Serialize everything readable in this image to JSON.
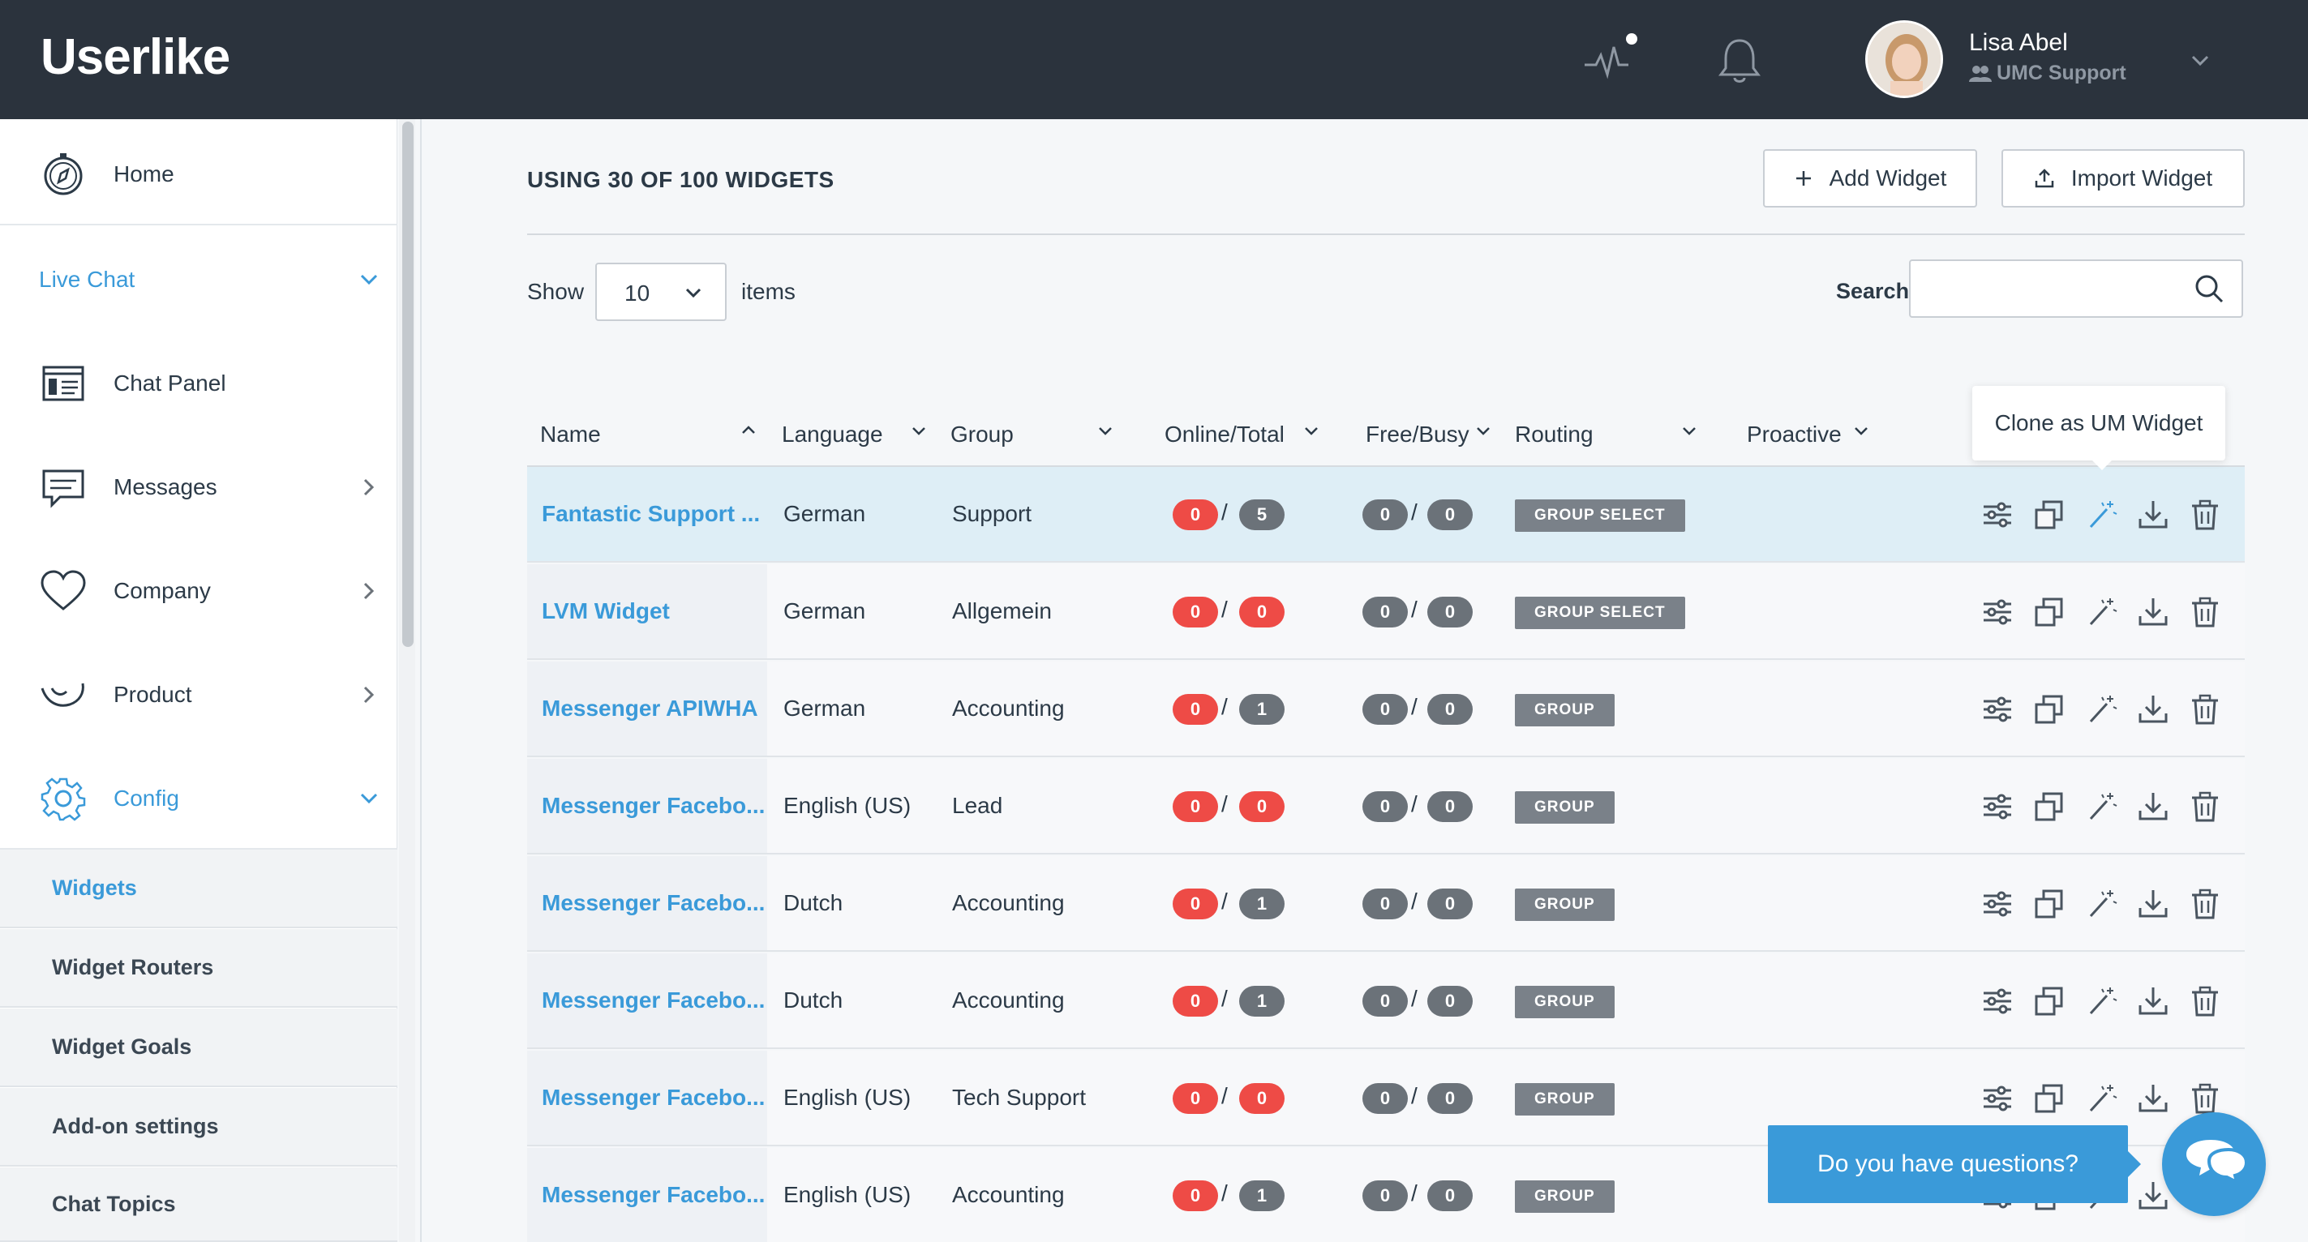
{
  "app": {
    "logo_text": "Userlike"
  },
  "user": {
    "name": "Lisa Abel",
    "role": "UMC Support"
  },
  "sidebar": {
    "home": "Home",
    "live_chat": "Live Chat",
    "chat_panel": "Chat Panel",
    "messages": "Messages",
    "company": "Company",
    "product": "Product",
    "config": "Config",
    "config_items": [
      "Widgets",
      "Widget Routers",
      "Widget Goals",
      "Add-on settings",
      "Chat Topics"
    ],
    "active_item": "Widgets"
  },
  "main": {
    "title": "USING 30 OF 100 WIDGETS",
    "add_widget": "Add Widget",
    "import_widget": "Import Widget",
    "show_label": "Show",
    "show_value": "10",
    "items_label": "items",
    "search_label": "Search",
    "search_value": ""
  },
  "table": {
    "columns": [
      "Name",
      "Language",
      "Group",
      "Online/Total",
      "Free/Busy",
      "Routing",
      "Proactive"
    ],
    "rows": [
      {
        "name": "Fantastic Support ...",
        "language": "German",
        "group": "Support",
        "online": "0",
        "total": "5",
        "free": "0",
        "busy": "0",
        "routing": "GROUP SELECT",
        "highlight": true
      },
      {
        "name": "LVM Widget",
        "language": "German",
        "group": "Allgemein",
        "online": "0",
        "total": "0",
        "free": "0",
        "busy": "0",
        "routing": "GROUP SELECT"
      },
      {
        "name": "Messenger APIWHA",
        "language": "German",
        "group": "Accounting",
        "online": "0",
        "total": "1",
        "free": "0",
        "busy": "0",
        "routing": "GROUP"
      },
      {
        "name": "Messenger Facebo...",
        "language": "English (US)",
        "group": "Lead",
        "online": "0",
        "total": "0",
        "free": "0",
        "busy": "0",
        "routing": "GROUP"
      },
      {
        "name": "Messenger Facebo...",
        "language": "Dutch",
        "group": "Accounting",
        "online": "0",
        "total": "1",
        "free": "0",
        "busy": "0",
        "routing": "GROUP"
      },
      {
        "name": "Messenger Facebo...",
        "language": "Dutch",
        "group": "Accounting",
        "online": "0",
        "total": "1",
        "free": "0",
        "busy": "0",
        "routing": "GROUP"
      },
      {
        "name": "Messenger Facebo...",
        "language": "English (US)",
        "group": "Tech Support",
        "online": "0",
        "total": "0",
        "free": "0",
        "busy": "0",
        "routing": "GROUP"
      },
      {
        "name": "Messenger Facebo...",
        "language": "English (US)",
        "group": "Accounting",
        "online": "0",
        "total": "1",
        "free": "0",
        "busy": "0",
        "routing": "GROUP"
      }
    ]
  },
  "tooltip": {
    "text": "Clone as UM Widget"
  },
  "chat_widget": {
    "prompt": "Do you have questions?"
  },
  "colors": {
    "topbar": "#2b333d",
    "accent": "#3a9ad9",
    "red_pill": "#ee4b46",
    "gray_pill": "#6b7279",
    "badge": "#7a8189"
  }
}
